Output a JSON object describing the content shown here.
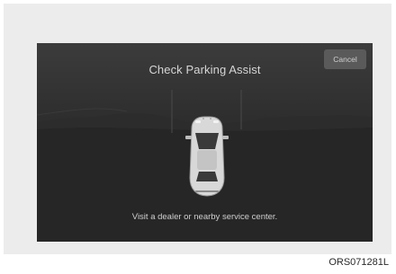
{
  "dialog": {
    "title": "Check Parking Assist",
    "cancel_label": "Cancel",
    "message": "Visit a dealer or nearby service center."
  },
  "figure_code": "ORS071281L"
}
